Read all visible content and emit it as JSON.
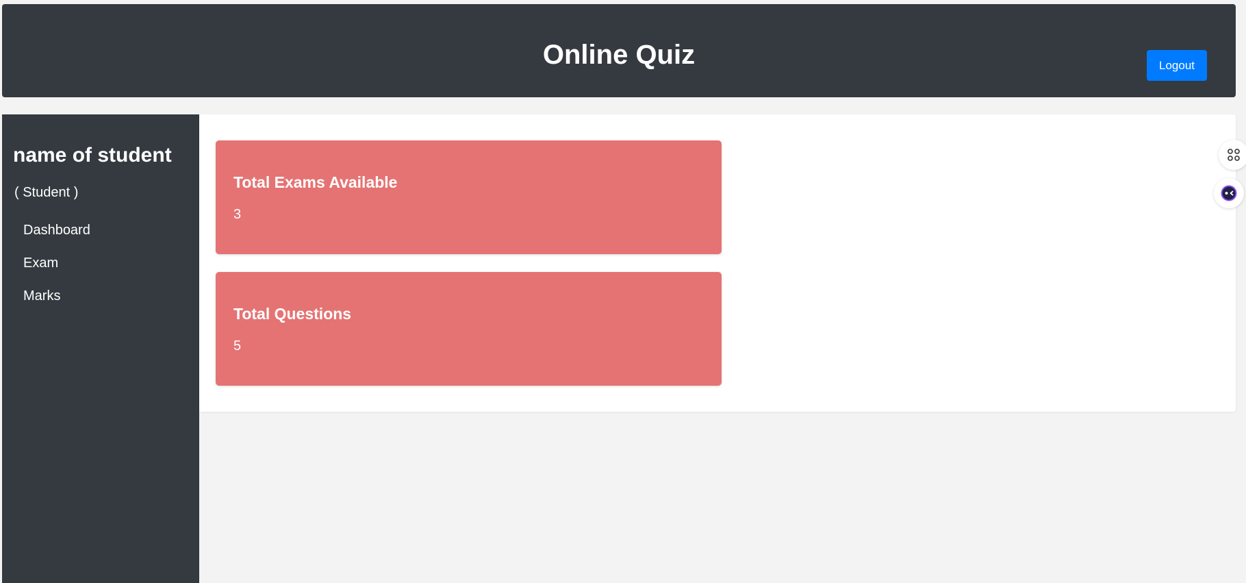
{
  "header": {
    "title": "Online Quiz",
    "logout_label": "Logout"
  },
  "sidebar": {
    "student_name": "name of student",
    "role": "( Student )",
    "items": [
      {
        "label": "Dashboard"
      },
      {
        "label": "Exam"
      },
      {
        "label": "Marks"
      }
    ]
  },
  "cards": [
    {
      "title": "Total Exams Available",
      "value": "3"
    },
    {
      "title": "Total Questions",
      "value": "5"
    }
  ],
  "colors": {
    "header_bg": "#343a40",
    "sidebar_bg": "#343a40",
    "accent_button": "#007bff",
    "card_bg": "#e57373",
    "page_bg": "#f3f3f3"
  },
  "widgets": [
    {
      "icon": "command-icon"
    },
    {
      "icon": "assistant-face-icon"
    }
  ]
}
